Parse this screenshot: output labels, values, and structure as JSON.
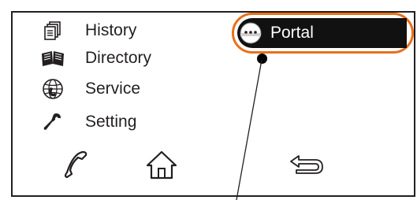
{
  "menu": {
    "items": [
      {
        "label": "History",
        "icon": "history-icon"
      },
      {
        "label": "Directory",
        "icon": "book-icon"
      },
      {
        "label": "Service",
        "icon": "globe-phone-icon"
      },
      {
        "label": "Setting",
        "icon": "wrench-icon"
      }
    ]
  },
  "portal": {
    "label": "Portal",
    "icon": "portal-icon",
    "highlight_color": "#e8701a"
  },
  "bottom_bar": {
    "icons": [
      "phone-handset-icon",
      "home-icon",
      "back-arrow-icon"
    ]
  }
}
